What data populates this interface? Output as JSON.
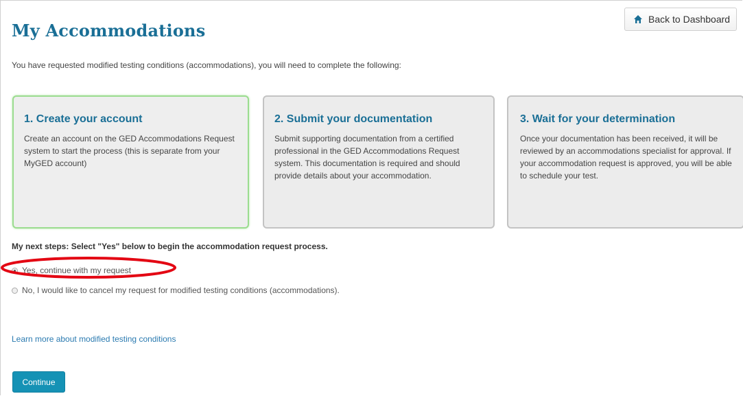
{
  "header": {
    "title": "My Accommodations",
    "back_label": "Back to Dashboard"
  },
  "intro": "You have requested modified testing conditions (accommodations), you will need to complete the following:",
  "steps": [
    {
      "title": "1. Create your account",
      "body": "Create an account on the GED Accommodations Request system to start the process (this is separate from your MyGED account)"
    },
    {
      "title": "2. Submit your documentation",
      "body": "Submit supporting documentation from a certified professional in the GED Accommodations Request system. This documentation is required and should provide details about your accommodation."
    },
    {
      "title": "3. Wait for your determination",
      "body": "Once your documentation has been received, it will be reviewed by an accommodations specialist for approval. If your accommodation request is approved, you will be able to schedule your test."
    }
  ],
  "next_steps": {
    "label": "My next steps: Select \"Yes\" below to begin the accommodation request process.",
    "options": [
      {
        "label": "Yes, continue with my request",
        "selected": true
      },
      {
        "label": "No, I would like to cancel my request for modified testing conditions (accommodations).",
        "selected": false
      }
    ]
  },
  "links": {
    "learn_more": "Learn more about modified testing conditions"
  },
  "actions": {
    "continue_label": "Continue"
  },
  "colors": {
    "brand": "#1a6f96",
    "button": "#1592b5",
    "active_card_border": "#9bdc8f",
    "annotation": "#e30613"
  },
  "icons": {
    "back": "home-icon"
  }
}
